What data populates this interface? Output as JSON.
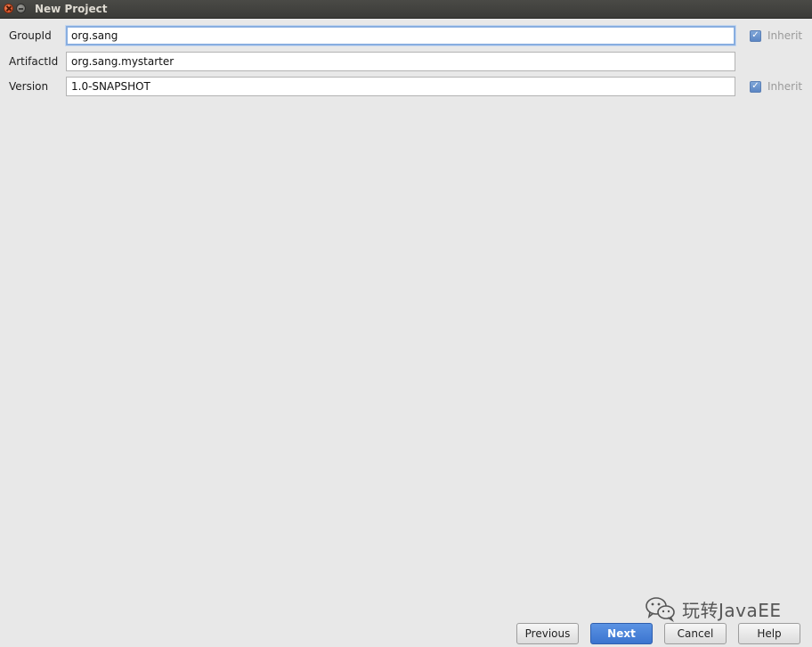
{
  "window": {
    "title": "New Project"
  },
  "form": {
    "group_id": {
      "label": "GroupId",
      "value": "org.sang",
      "inherit_label": "Inherit",
      "inherit_checked": true
    },
    "artifact_id": {
      "label": "ArtifactId",
      "value": "org.sang.mystarter"
    },
    "version": {
      "label": "Version",
      "value": "1.0-SNAPSHOT",
      "inherit_label": "Inherit",
      "inherit_checked": true
    }
  },
  "footer": {
    "previous_label": "Previous",
    "next_label": "Next",
    "cancel_label": "Cancel",
    "help_label": "Help"
  },
  "watermark": {
    "text": "玩转JavaEE",
    "icon": "wechat-icon"
  },
  "colors": {
    "background": "#e8e8e8",
    "titlebar": "#3c3b37",
    "accent": "#3b74cf",
    "focus_border": "#88aee0"
  }
}
